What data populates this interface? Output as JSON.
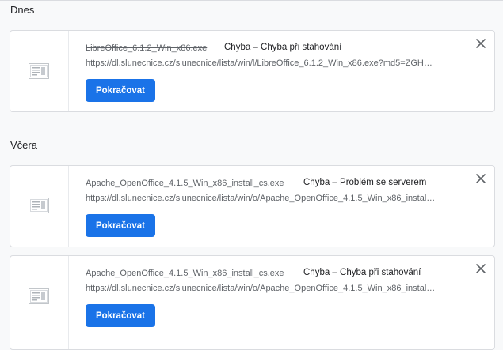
{
  "sections": [
    {
      "title": "Dnes",
      "items": [
        {
          "filename": "LibreOffice_6.1.2_Win_x86.exe",
          "status": "Chyba – Chyba při stahování",
          "url": "https://dl.slunecnice.cz/slunecnice/lista/win/l/LibreOffice_6.1.2_Win_x86.exe?md5=ZGH…",
          "button_label": "Pokračovat"
        }
      ]
    },
    {
      "title": "Včera",
      "items": [
        {
          "filename": "Apache_OpenOffice_4.1.5_Win_x86_install_cs.exe",
          "status": "Chyba – Problém se serverem",
          "url": "https://dl.slunecnice.cz/slunecnice/lista/win/o/Apache_OpenOffice_4.1.5_Win_x86_instal…",
          "button_label": "Pokračovat"
        },
        {
          "filename": "Apache_OpenOffice_4.1.5_Win_x86_install_cs.exe",
          "status": "Chyba – Chyba při stahování",
          "url": "https://dl.slunecnice.cz/slunecnice/lista/win/o/Apache_OpenOffice_4.1.5_Win_x86_instal…",
          "button_label": "Pokračovat"
        }
      ]
    }
  ],
  "icons": {
    "file": "file-icon",
    "close": "close-icon"
  },
  "colors": {
    "accent": "#1a73e8",
    "background": "#f8f9fa",
    "card": "#ffffff",
    "border": "#dadce0",
    "secondary_text": "#5f6368"
  }
}
